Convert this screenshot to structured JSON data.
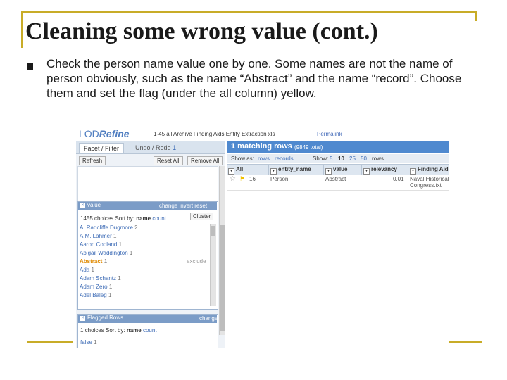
{
  "slide": {
    "title": "Cleaning some wrong value (cont.)",
    "bullet_text": "Check the person name value one by one. Some names are not the name of person obviously, such as the name “Abstract” and the name “record”. Choose them and set the flag (under the all column) yellow."
  },
  "colors": {
    "accent": "#c8ac28",
    "refine_blue": "#4f89cf",
    "link_blue": "#3e6cb6",
    "flag_yellow": "#f0c000"
  },
  "app": {
    "logo_lod": "LOD",
    "logo_refine": "Refine",
    "project_name": "1-45 all Archive Finding Aids Entity Extraction xls",
    "permalink": "Permalink",
    "tabs": {
      "facet_filter": "Facet / Filter",
      "undo_redo": "Undo / Redo",
      "undo_count": "1"
    },
    "buttons": {
      "refresh": "Refresh",
      "reset_all": "Reset All",
      "remove_all": "Remove All"
    },
    "value_facet": {
      "title": "value",
      "actions": {
        "change": "change",
        "invert": "invert",
        "reset": "reset"
      },
      "choices_count": "1455 choices",
      "sort_by_label": "Sort by:",
      "sort_name": "name",
      "sort_count": "count",
      "cluster": "Cluster",
      "items": [
        {
          "name": "A. Radcliffe Dugmore",
          "count": "2"
        },
        {
          "name": "A.M. Lahmer",
          "count": "1"
        },
        {
          "name": "Aaron Copland",
          "count": "1"
        },
        {
          "name": "Abigail Waddington",
          "count": "1"
        },
        {
          "name": "Abstract",
          "count": "1",
          "extra": "exclude"
        },
        {
          "name": "Ada",
          "count": "1"
        },
        {
          "name": "Adam Schantz",
          "count": "1"
        },
        {
          "name": "Adam Zero",
          "count": "1"
        },
        {
          "name": "Adel Baleg",
          "count": "1"
        }
      ]
    },
    "flagged_facet": {
      "title": "Flagged Rows",
      "action": "change",
      "choices_count": "1 choices",
      "sort_by_label": "Sort by:",
      "sort_name": "name",
      "sort_count": "count",
      "items": [
        {
          "name": "false",
          "count": "1"
        }
      ]
    },
    "results": {
      "matching": "1 matching rows",
      "total": "(9849 total)",
      "show_as_label": "Show as:",
      "show_as_rows": "rows",
      "show_as_records": "records",
      "show_label": "Show:",
      "page_sizes": [
        "5",
        "10",
        "25",
        "50"
      ],
      "page_sizes_suffix": "rows",
      "columns": [
        "All",
        "entity_name",
        "value",
        "relevancy",
        "Finding Aids"
      ],
      "row": {
        "index": "16",
        "entity_name": "Person",
        "value": "Abstract",
        "relevancy": "0.01",
        "finding_aids": "Naval Historical Congress.txt"
      }
    }
  }
}
